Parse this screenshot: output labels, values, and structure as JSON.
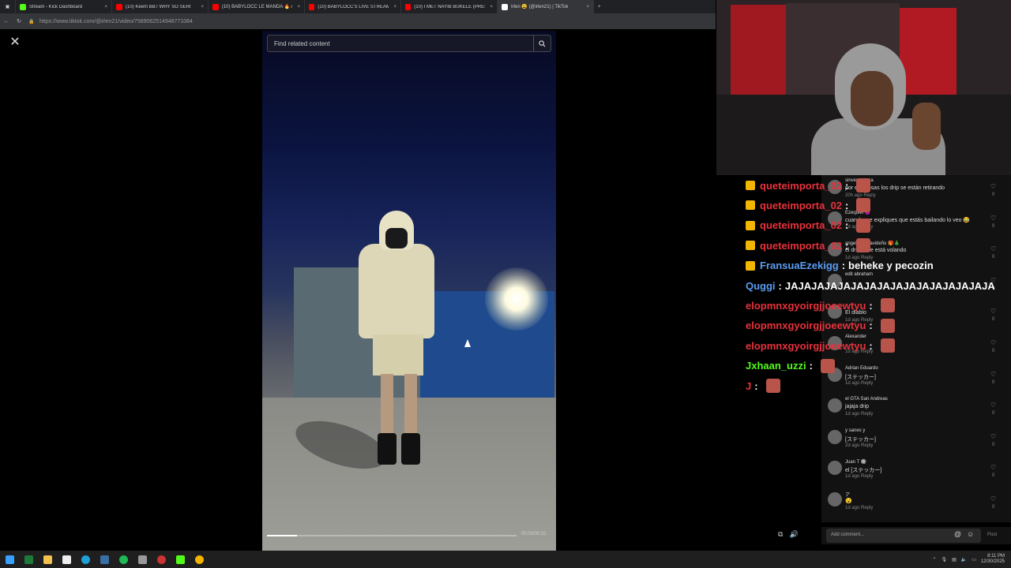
{
  "browser": {
    "tabs": [
      {
        "title": "Stream - Kick Dashboard",
        "color": "#53fc18"
      },
      {
        "title": "(10) Keem BB7 WHY SO SERI",
        "color": "#ff0000"
      },
      {
        "title": "(10) BABYLOCC LE MANDA 🔥 A",
        "color": "#ff0000"
      },
      {
        "title": "(10) BABYLOCC'S LIVE STREAM R",
        "color": "#ff0000"
      },
      {
        "title": "(10) I MET NAYIB BUKELE (PRESID",
        "color": "#ff0000"
      },
      {
        "title": "Irlen 😩 (@irlen21) | TikTok",
        "color": "#ffffff"
      }
    ],
    "new_tab": "+",
    "url": "https://www.tiktok.com/@irlen21/video/7589062514948771084"
  },
  "tiktok": {
    "search_placeholder": "Find related content",
    "close": "✕",
    "time": "00:03/00:31",
    "progress": 0.12
  },
  "chat": [
    {
      "user": "queteimporta_02",
      "color": "#e8323c",
      "crown": true,
      "msg": ""
    },
    {
      "user": "queteimporta_02",
      "color": "#e8323c",
      "crown": true,
      "msg": ""
    },
    {
      "user": "queteimporta_02",
      "color": "#e8323c",
      "crown": true,
      "msg": ""
    },
    {
      "user": "queteimporta_02",
      "color": "#e8323c",
      "crown": true,
      "msg": ""
    },
    {
      "user": "FransuaEzekigg",
      "color": "#5c9cf2",
      "crown": true,
      "msg": "beheke y pecozin"
    },
    {
      "user": "Quggi",
      "color": "#5c9cf2",
      "crown": false,
      "msg": "JAJAJAJAJAJAJAJAJAJAJAJAJAJAJAJA"
    },
    {
      "user": "elopmnxgyoirgjjoeewtyu",
      "color": "#e8323c",
      "crown": false,
      "msg": ""
    },
    {
      "user": "elopmnxgyoirgjjoeewtyu",
      "color": "#e8323c",
      "crown": false,
      "msg": ""
    },
    {
      "user": "elopmnxgyoirgjjoeewtyu",
      "color": "#e8323c",
      "crown": false,
      "msg": ""
    },
    {
      "user": "Jxhaan_uzzi",
      "color": "#53fc18",
      "crown": false,
      "msg": ""
    },
    {
      "user": "J",
      "color": "#e8323c",
      "crown": false,
      "msg": ""
    }
  ],
  "comments": [
    {
      "name": "sinverguenza",
      "text": "por eso cosas los drip se están retirando",
      "meta": "20h ago   Reply",
      "count": "0"
    },
    {
      "name": "Ezequiel 😈",
      "text": "cuando me expliques que estás bailando lo veo 😂",
      "meta": "1d ago   Reply",
      "count": "0"
    },
    {
      "name": "angel real navideño 🎁🎄",
      "text": "el drip se le está volando",
      "meta": "1d ago   Reply",
      "count": "0"
    },
    {
      "name": "edit abraham",
      "text": "",
      "meta": "",
      "count": "0"
    },
    {
      "name": "",
      "text": "El diablo",
      "meta": "1d ago   Reply",
      "count": "0"
    },
    {
      "name": "Alexander",
      "text": "",
      "meta": "1d ago   Reply",
      "count": "0"
    },
    {
      "name": "Adrian Eduardo",
      "text": "[ステッカー]",
      "meta": "1d ago   Reply",
      "count": "0"
    },
    {
      "name": "el GTA San Andreas",
      "text": "jajaja drip",
      "meta": "1d ago   Reply",
      "count": "0"
    },
    {
      "name": "y sanes y",
      "text": "[ステッカー]",
      "meta": "2d ago   Reply",
      "count": "0"
    },
    {
      "name": "Juan T 🔘",
      "text": "el [ステッカー]",
      "meta": "1d ago   Reply",
      "count": "0"
    },
    {
      "name": "ア",
      "text": "😮",
      "meta": "1d ago   Reply",
      "count": "0"
    }
  ],
  "add_comment": {
    "placeholder": "Add comment...",
    "at": "@",
    "emoji": "☺",
    "post": "Post"
  },
  "taskbar": {
    "time": "8:11 PM",
    "date": "12/30/2025"
  }
}
